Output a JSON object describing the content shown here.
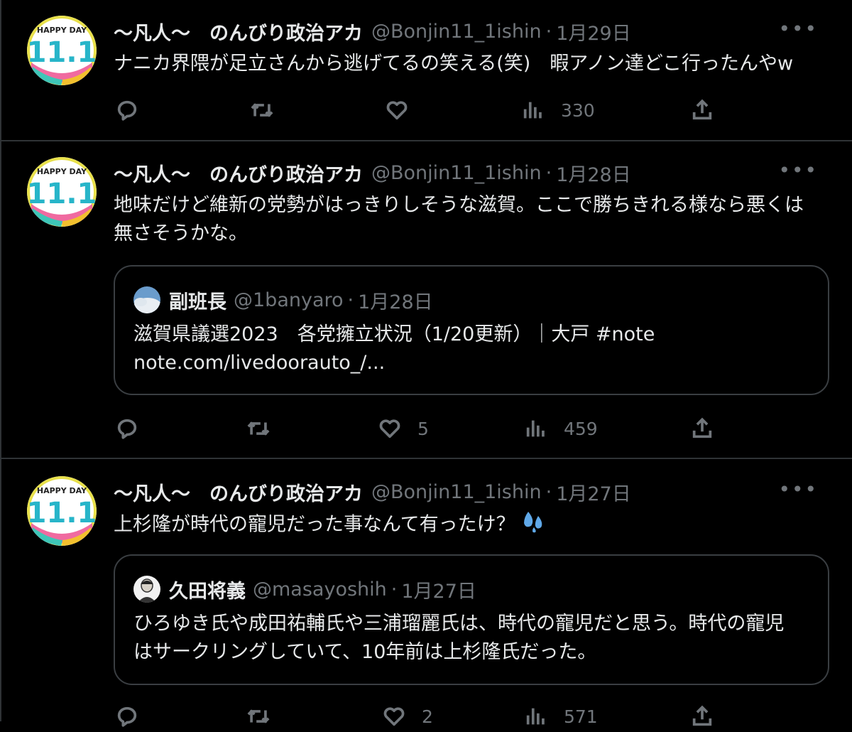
{
  "colors": {
    "background": "#000000",
    "text": "#e7e9ea",
    "muted": "#71767b",
    "divider": "#2f3336",
    "drop_emoji": "#5fa8e8"
  },
  "tweets": [
    {
      "name": "〜凡人〜　のんびり政治アカ",
      "handle": "@Bonjin11_1ishin",
      "sep": "·",
      "date": "1月29日",
      "more": "•••",
      "text": "ナニカ界隈が足立さんから逃げてるの笑える(笑)　暇アノン達どこ行ったんやw",
      "avatar_text": {
        "line1": "HAPPY DAY",
        "line2": "11.1"
      },
      "actions": {
        "reply": "",
        "retweet": "",
        "like": "",
        "views": "330"
      },
      "icons": [
        "reply-icon",
        "retweet-icon",
        "like-icon",
        "views-icon",
        "share-icon"
      ]
    },
    {
      "name": "〜凡人〜　のんびり政治アカ",
      "handle": "@Bonjin11_1ishin",
      "sep": "·",
      "date": "1月28日",
      "more": "•••",
      "text_lines": [
        "地味だけど維新の党勢がはっきりしそうな滋賀。ここで勝ちきれる様なら悪くは",
        "無さそうかな。"
      ],
      "avatar_text": {
        "line1": "HAPPY DAY",
        "line2": "11.1"
      },
      "quote": {
        "name": "副班長",
        "handle": "@1banyaro",
        "sep": "·",
        "date": "1月28日",
        "text_lines": [
          "滋賀県議選2023　各党擁立状況（1/20更新）｜大戸 #note",
          "note.com/livedoorauto_/..."
        ]
      },
      "actions": {
        "reply": "",
        "retweet": "",
        "like": "5",
        "views": "459"
      }
    },
    {
      "name": "〜凡人〜　のんびり政治アカ",
      "handle": "@Bonjin11_1ishin",
      "sep": "·",
      "date": "1月27日",
      "more": "•••",
      "text": "上杉隆が時代の寵児だった事なんて有ったけ？",
      "emoji": "sweat-droplets-emoji",
      "avatar_text": {
        "line1": "HAPPY DAY",
        "line2": "11.1"
      },
      "quote": {
        "name": "久田将義",
        "handle": "@masayoshih",
        "sep": "·",
        "date": "1月27日",
        "text_lines": [
          "ひろゆき氏や成田祐輔氏や三浦瑠麗氏は、時代の寵児だと思う。時代の寵児",
          "はサークリングしていて、10年前は上杉隆氏だった。"
        ]
      },
      "actions": {
        "reply": "",
        "retweet": "",
        "like": "2",
        "views": "571"
      }
    }
  ]
}
